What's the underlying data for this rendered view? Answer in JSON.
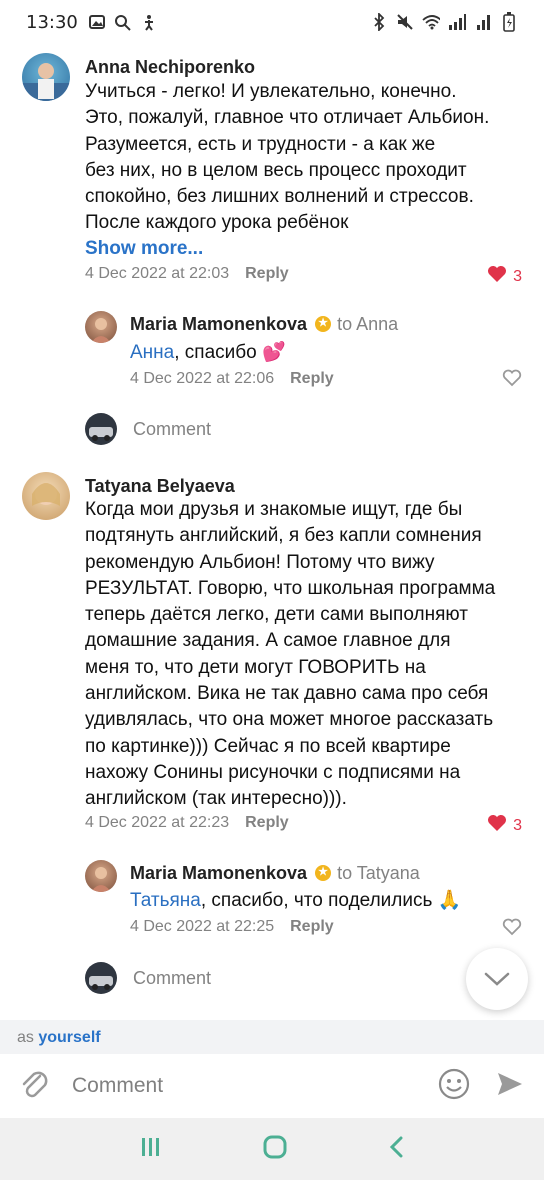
{
  "status_bar": {
    "time": "13:30"
  },
  "comments": [
    {
      "author": "Anna Nechiporenko",
      "lines": [
        "Учиться - легко! И увлекательно, конечно.",
        "Это, пожалуй, главное что отличает Альбион.",
        "Разумеется, есть и трудности - а как же",
        "без них, но в целом весь процесс проходит",
        "спокойно, без лишних волнений и стрессов.",
        "После каждого урока ребёнок"
      ],
      "show_more": "Show more...",
      "date": "4 Dec 2022 at 22:03",
      "reply_label": "Reply",
      "likes": "3",
      "reply": {
        "author": "Maria Mamonenkova",
        "to": "to Anna",
        "mention": "Анна",
        "text": ", спасибо 💕",
        "date": "4 Dec 2022 at 22:06",
        "reply_label": "Reply"
      },
      "comment_label": "Comment"
    },
    {
      "author": "Tatyana Belyaeva",
      "lines": [
        "Когда мои друзья и знакомые ищут, где бы",
        "подтянуть английский, я без капли сомнения",
        "рекомендую Альбион! Потому что вижу",
        "РЕЗУЛЬТАТ. Говорю, что школьная программа",
        "теперь даётся легко, дети сами выполняют",
        "домашние задания. А самое главное для",
        "меня то, что дети могут ГОВОРИТЬ на",
        "английском. Вика не так давно сама про себя",
        "удивлялась, что она может многое рассказать",
        "по картинке))) Сейчас я по всей квартире",
        "нахожу Сонины рисуночки с подписями на",
        "английском (так интересно)))."
      ],
      "date": "4 Dec 2022 at 22:23",
      "reply_label": "Reply",
      "likes": "3",
      "reply": {
        "author": "Maria Mamonenkova",
        "to": "to Tatyana",
        "mention": "Татьяна",
        "text": ", спасибо, что поделились 🙏",
        "date": "4 Dec 2022 at 22:25",
        "reply_label": "Reply"
      },
      "comment_label": "Comment"
    }
  ],
  "as_bar": {
    "prefix": "as",
    "who": "yourself"
  },
  "composer": {
    "placeholder": "Comment"
  },
  "colors": {
    "link": "#2a73c8",
    "like": "#e0334a",
    "meta": "#828282"
  }
}
